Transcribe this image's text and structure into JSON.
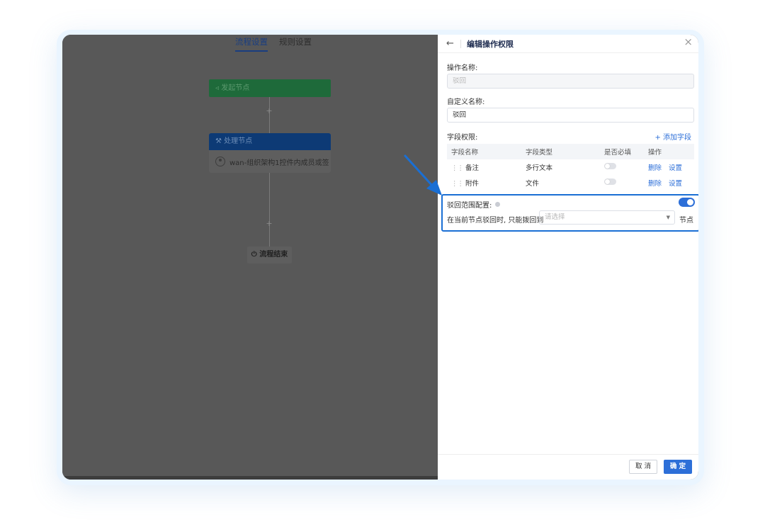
{
  "canvas": {
    "tabs": [
      {
        "label": "流程设置",
        "active": true
      },
      {
        "label": "规则设置",
        "active": false
      }
    ],
    "start_node": {
      "icon": "send-icon",
      "label": "发起节点"
    },
    "process_node": {
      "icon": "wrench-icon",
      "label": "处理节点",
      "member": "wan-组织架构1控件内成员或签"
    },
    "end_node": {
      "icon": "power-icon",
      "label": "流程结束"
    },
    "add_symbol": "+"
  },
  "panel": {
    "back_icon": "←",
    "title": "编辑操作权限",
    "close_icon": "×",
    "op_name_label": "操作名称:",
    "op_name_value": "驳回",
    "custom_name_label": "自定义名称:",
    "custom_name_value": "驳回",
    "field_perm_label": "字段权限:",
    "add_field": "+ 添加字段",
    "table": {
      "headers": [
        "字段名称",
        "字段类型",
        "是否必填",
        "操作"
      ],
      "rows": [
        {
          "name": "备注",
          "type": "多行文本",
          "required": false,
          "delete": "删除",
          "settings": "设置"
        },
        {
          "name": "附件",
          "type": "文件",
          "required": false,
          "delete": "删除",
          "settings": "设置"
        }
      ]
    },
    "reject_range_label": "驳回范围配置:",
    "reject_range_enabled": true,
    "reject_prefix": "在当前节点驳回时, 只能拨回到",
    "select_placeholder": "请选择",
    "reject_suffix": "节点",
    "cancel_label": "取 消",
    "ok_label": "确 定"
  },
  "colors": {
    "accent": "#2d6fd8",
    "highlight": "#1a6fd4",
    "overlay": "#585858"
  }
}
